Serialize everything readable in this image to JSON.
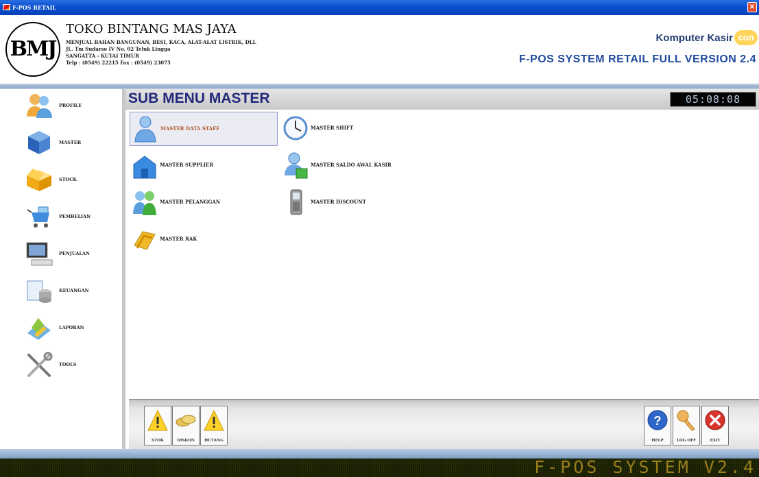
{
  "window": {
    "title": "F-POS RETAIL",
    "close_glyph": "✕"
  },
  "header": {
    "logo_text": "BMJ",
    "store_name": "TOKO BINTANG MAS JAYA",
    "store_lines": [
      "MENJUAL BAHAN BANGUNAN, BESI, KACA, ALAT-ALAT LISTRIK, DLL",
      "JL. Tm Sudarso IV No. 02 Teluk Lingga",
      "SANGATTA - KUTAI TIMUR",
      "Telp : (0549) 22215 Fax : (0549) 23075"
    ],
    "brand_line1": "Komputer Kasir",
    "brand_coin": "con",
    "brand_line2": "F-POS SYSTEM RETAIL FULL VERSION 2.4"
  },
  "sidebar": {
    "items": [
      {
        "label": "PROFILE",
        "icon": "users-icon"
      },
      {
        "label": "MASTER",
        "icon": "cube-icon"
      },
      {
        "label": "STOCK",
        "icon": "box-icon"
      },
      {
        "label": "PEMBELIAN",
        "icon": "cart-icon"
      },
      {
        "label": "PENJUALAN",
        "icon": "monitor-icon"
      },
      {
        "label": "KEUANGAN",
        "icon": "finance-icon"
      },
      {
        "label": "LAPORAN",
        "icon": "report-icon"
      },
      {
        "label": "TOOLS",
        "icon": "tools-icon"
      }
    ]
  },
  "main": {
    "title": "SUB MENU MASTER",
    "clock": "05:08:08",
    "menu_items": [
      {
        "label": "MASTER DATA STAFF",
        "icon": "staff-icon",
        "active": true
      },
      {
        "label": "MASTER SHIFT",
        "icon": "clock-icon",
        "active": false
      },
      {
        "label": "MASTER SUPPLIER",
        "icon": "supplier-icon",
        "active": false
      },
      {
        "label": "MASTER SALDO AWAL KASIR",
        "icon": "cashier-icon",
        "active": false
      },
      {
        "label": "MASTER PELANGGAN",
        "icon": "customer-icon",
        "active": false
      },
      {
        "label": "MASTER DISCOUNT",
        "icon": "phone-discount-icon",
        "active": false
      },
      {
        "label": "MASTER RAK",
        "icon": "rack-icon",
        "active": false
      }
    ]
  },
  "toolbar": {
    "left": [
      {
        "label": "STOK",
        "icon": "warning-icon"
      },
      {
        "label": "DISKON",
        "icon": "coins-icon"
      },
      {
        "label": "HUTANG",
        "icon": "warning-icon"
      }
    ],
    "right": [
      {
        "label": "HELP",
        "icon": "help-icon"
      },
      {
        "label": "LOG OFF",
        "icon": "key-icon"
      },
      {
        "label": "EXIT",
        "icon": "exit-icon"
      }
    ]
  },
  "footer": {
    "marquee": "F-POS SYSTEM V2.4"
  },
  "colors": {
    "title_blue": "#22287a",
    "active_label": "#b45a2c",
    "brand_blue": "#1f4a9e"
  }
}
